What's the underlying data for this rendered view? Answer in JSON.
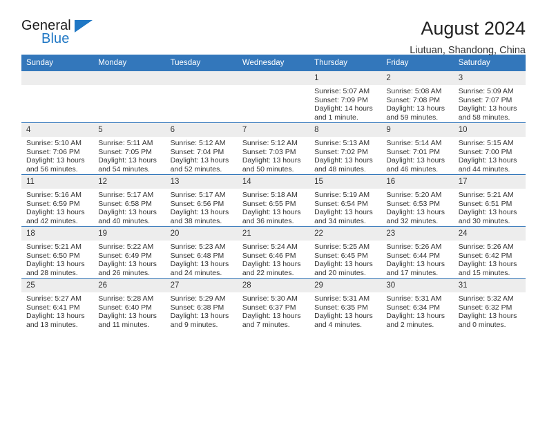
{
  "brand": {
    "name_part1": "General",
    "name_part2": "Blue",
    "flag_icon": "triangle-flag-icon"
  },
  "header": {
    "title": "August 2024",
    "location": "Liutuan, Shandong, China"
  },
  "calendar": {
    "weekday_headers": [
      "Sunday",
      "Monday",
      "Tuesday",
      "Wednesday",
      "Thursday",
      "Friday",
      "Saturday"
    ],
    "colors": {
      "header_background": "#3377bb",
      "header_text": "#ffffff",
      "daynum_background": "#ededed",
      "row_divider": "#3377bb",
      "brand_blue": "#1f77c4",
      "body_text": "#333333"
    },
    "weeks": [
      [
        {
          "day": "",
          "empty": true
        },
        {
          "day": "",
          "empty": true
        },
        {
          "day": "",
          "empty": true
        },
        {
          "day": "",
          "empty": true
        },
        {
          "day": "1",
          "sunrise": "Sunrise: 5:07 AM",
          "sunset": "Sunset: 7:09 PM",
          "daylight_line1": "Daylight: 14 hours",
          "daylight_line2": "and 1 minute."
        },
        {
          "day": "2",
          "sunrise": "Sunrise: 5:08 AM",
          "sunset": "Sunset: 7:08 PM",
          "daylight_line1": "Daylight: 13 hours",
          "daylight_line2": "and 59 minutes."
        },
        {
          "day": "3",
          "sunrise": "Sunrise: 5:09 AM",
          "sunset": "Sunset: 7:07 PM",
          "daylight_line1": "Daylight: 13 hours",
          "daylight_line2": "and 58 minutes."
        }
      ],
      [
        {
          "day": "4",
          "sunrise": "Sunrise: 5:10 AM",
          "sunset": "Sunset: 7:06 PM",
          "daylight_line1": "Daylight: 13 hours",
          "daylight_line2": "and 56 minutes."
        },
        {
          "day": "5",
          "sunrise": "Sunrise: 5:11 AM",
          "sunset": "Sunset: 7:05 PM",
          "daylight_line1": "Daylight: 13 hours",
          "daylight_line2": "and 54 minutes."
        },
        {
          "day": "6",
          "sunrise": "Sunrise: 5:12 AM",
          "sunset": "Sunset: 7:04 PM",
          "daylight_line1": "Daylight: 13 hours",
          "daylight_line2": "and 52 minutes."
        },
        {
          "day": "7",
          "sunrise": "Sunrise: 5:12 AM",
          "sunset": "Sunset: 7:03 PM",
          "daylight_line1": "Daylight: 13 hours",
          "daylight_line2": "and 50 minutes."
        },
        {
          "day": "8",
          "sunrise": "Sunrise: 5:13 AM",
          "sunset": "Sunset: 7:02 PM",
          "daylight_line1": "Daylight: 13 hours",
          "daylight_line2": "and 48 minutes."
        },
        {
          "day": "9",
          "sunrise": "Sunrise: 5:14 AM",
          "sunset": "Sunset: 7:01 PM",
          "daylight_line1": "Daylight: 13 hours",
          "daylight_line2": "and 46 minutes."
        },
        {
          "day": "10",
          "sunrise": "Sunrise: 5:15 AM",
          "sunset": "Sunset: 7:00 PM",
          "daylight_line1": "Daylight: 13 hours",
          "daylight_line2": "and 44 minutes."
        }
      ],
      [
        {
          "day": "11",
          "sunrise": "Sunrise: 5:16 AM",
          "sunset": "Sunset: 6:59 PM",
          "daylight_line1": "Daylight: 13 hours",
          "daylight_line2": "and 42 minutes."
        },
        {
          "day": "12",
          "sunrise": "Sunrise: 5:17 AM",
          "sunset": "Sunset: 6:58 PM",
          "daylight_line1": "Daylight: 13 hours",
          "daylight_line2": "and 40 minutes."
        },
        {
          "day": "13",
          "sunrise": "Sunrise: 5:17 AM",
          "sunset": "Sunset: 6:56 PM",
          "daylight_line1": "Daylight: 13 hours",
          "daylight_line2": "and 38 minutes."
        },
        {
          "day": "14",
          "sunrise": "Sunrise: 5:18 AM",
          "sunset": "Sunset: 6:55 PM",
          "daylight_line1": "Daylight: 13 hours",
          "daylight_line2": "and 36 minutes."
        },
        {
          "day": "15",
          "sunrise": "Sunrise: 5:19 AM",
          "sunset": "Sunset: 6:54 PM",
          "daylight_line1": "Daylight: 13 hours",
          "daylight_line2": "and 34 minutes."
        },
        {
          "day": "16",
          "sunrise": "Sunrise: 5:20 AM",
          "sunset": "Sunset: 6:53 PM",
          "daylight_line1": "Daylight: 13 hours",
          "daylight_line2": "and 32 minutes."
        },
        {
          "day": "17",
          "sunrise": "Sunrise: 5:21 AM",
          "sunset": "Sunset: 6:51 PM",
          "daylight_line1": "Daylight: 13 hours",
          "daylight_line2": "and 30 minutes."
        }
      ],
      [
        {
          "day": "18",
          "sunrise": "Sunrise: 5:21 AM",
          "sunset": "Sunset: 6:50 PM",
          "daylight_line1": "Daylight: 13 hours",
          "daylight_line2": "and 28 minutes."
        },
        {
          "day": "19",
          "sunrise": "Sunrise: 5:22 AM",
          "sunset": "Sunset: 6:49 PM",
          "daylight_line1": "Daylight: 13 hours",
          "daylight_line2": "and 26 minutes."
        },
        {
          "day": "20",
          "sunrise": "Sunrise: 5:23 AM",
          "sunset": "Sunset: 6:48 PM",
          "daylight_line1": "Daylight: 13 hours",
          "daylight_line2": "and 24 minutes."
        },
        {
          "day": "21",
          "sunrise": "Sunrise: 5:24 AM",
          "sunset": "Sunset: 6:46 PM",
          "daylight_line1": "Daylight: 13 hours",
          "daylight_line2": "and 22 minutes."
        },
        {
          "day": "22",
          "sunrise": "Sunrise: 5:25 AM",
          "sunset": "Sunset: 6:45 PM",
          "daylight_line1": "Daylight: 13 hours",
          "daylight_line2": "and 20 minutes."
        },
        {
          "day": "23",
          "sunrise": "Sunrise: 5:26 AM",
          "sunset": "Sunset: 6:44 PM",
          "daylight_line1": "Daylight: 13 hours",
          "daylight_line2": "and 17 minutes."
        },
        {
          "day": "24",
          "sunrise": "Sunrise: 5:26 AM",
          "sunset": "Sunset: 6:42 PM",
          "daylight_line1": "Daylight: 13 hours",
          "daylight_line2": "and 15 minutes."
        }
      ],
      [
        {
          "day": "25",
          "sunrise": "Sunrise: 5:27 AM",
          "sunset": "Sunset: 6:41 PM",
          "daylight_line1": "Daylight: 13 hours",
          "daylight_line2": "and 13 minutes."
        },
        {
          "day": "26",
          "sunrise": "Sunrise: 5:28 AM",
          "sunset": "Sunset: 6:40 PM",
          "daylight_line1": "Daylight: 13 hours",
          "daylight_line2": "and 11 minutes."
        },
        {
          "day": "27",
          "sunrise": "Sunrise: 5:29 AM",
          "sunset": "Sunset: 6:38 PM",
          "daylight_line1": "Daylight: 13 hours",
          "daylight_line2": "and 9 minutes."
        },
        {
          "day": "28",
          "sunrise": "Sunrise: 5:30 AM",
          "sunset": "Sunset: 6:37 PM",
          "daylight_line1": "Daylight: 13 hours",
          "daylight_line2": "and 7 minutes."
        },
        {
          "day": "29",
          "sunrise": "Sunrise: 5:31 AM",
          "sunset": "Sunset: 6:35 PM",
          "daylight_line1": "Daylight: 13 hours",
          "daylight_line2": "and 4 minutes."
        },
        {
          "day": "30",
          "sunrise": "Sunrise: 5:31 AM",
          "sunset": "Sunset: 6:34 PM",
          "daylight_line1": "Daylight: 13 hours",
          "daylight_line2": "and 2 minutes."
        },
        {
          "day": "31",
          "sunrise": "Sunrise: 5:32 AM",
          "sunset": "Sunset: 6:32 PM",
          "daylight_line1": "Daylight: 13 hours",
          "daylight_line2": "and 0 minutes."
        }
      ]
    ]
  }
}
